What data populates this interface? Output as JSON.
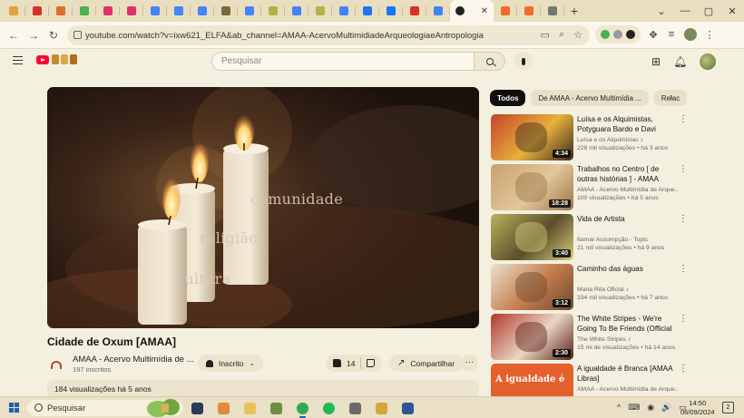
{
  "browser": {
    "tab_favicon_colors": [
      "#e0a33a",
      "#d93025",
      "#e06c2c",
      "#4caf50",
      "#e1306c",
      "#e1306c",
      "#4285f4",
      "#4285f4",
      "#4285f4",
      "#7a6a3a",
      "#4285f4",
      "#b7b04a",
      "#4285f4",
      "#b7b04a",
      "#4285f4",
      "#1877f2",
      "#1877f2",
      "#d93025",
      "#4285f4"
    ],
    "active_tab_icon": "youtube-music-icon",
    "after_tabs": [
      "#f36a2a",
      "#f36a2a",
      "#777777"
    ],
    "new_tab": "+",
    "url": "youtube.com/watch?v=ixw621_ELFA&ab_channel=AMAA-AcervoMultimidiadeArqueologiaeAntropologia",
    "window_controls": [
      "⌄",
      "—",
      "▢",
      "✕"
    ]
  },
  "masthead": {
    "search_placeholder": "Pesquisar"
  },
  "player": {
    "overlay_words": [
      "comunidade",
      "religião",
      "cultura"
    ]
  },
  "video": {
    "title": "Cidade de Oxum [AMAA]",
    "channel_name": "AMAA - Acervo Multimídia de ...",
    "subscribers": "197 inscritos",
    "subscribe_label": "Inscrito",
    "likes": "14",
    "share_label": "Compartilhar",
    "more_label": "···",
    "stats": "184 visualizações  há 5 anos"
  },
  "chips": [
    "Todos",
    "De AMAA - Acervo Multimídia ...",
    "Relac"
  ],
  "related": [
    {
      "title": "Luísa e os Alquimistas, Potyguara Bardo e Davi Sabbag...",
      "channel": "Luísa e os Alquimistas ♪",
      "meta": "228 mil visualizações • há 3 anos",
      "duration": "4:34",
      "thumb_colors": [
        "#c4432a",
        "#e7b13c",
        "#3c2a1e"
      ]
    },
    {
      "title": "Trabalhos no Centro [ de outras histórias ] - AMAA",
      "channel": "AMAA - Acervo Multimídia de Arque...",
      "meta": "100 visualizações • há 5 anos",
      "duration": "18:28",
      "thumb_colors": [
        "#c8a070",
        "#e2c89a",
        "#9c7446"
      ]
    },
    {
      "title": "Vida de Artista",
      "channel": "Itamar Assumpção - Topic",
      "meta": "21 mil visualizações • há 9 anos",
      "duration": "3:40",
      "thumb_colors": [
        "#b9b25a",
        "#5b4e2c",
        "#d9cf7c"
      ]
    },
    {
      "title": "Caminho das águas",
      "channel": "Maria Rita Oficial ♪",
      "meta": "334 mil visualizações • há 7 anos",
      "duration": "3:12",
      "thumb_colors": [
        "#e9e1cf",
        "#c47a4a",
        "#6b4a30"
      ]
    },
    {
      "title": "The White Stripes - We're Going To Be Friends (Official Music...",
      "channel": "The White Stripes ♪",
      "meta": "15 mi de visualizações • há 14 anos",
      "duration": "2:30",
      "thumb_colors": [
        "#b4372c",
        "#e8d6c2",
        "#5a1c16"
      ]
    },
    {
      "title": "A igualdade é Branca [AMAA Libras]",
      "channel": "AMAA - Acervo Multimídia de Arque...",
      "meta": "",
      "duration": "",
      "thumb_text": "A igualdade é",
      "thumb_colors": [
        "#e5602c",
        "#ffffff",
        "#7a2a14"
      ]
    }
  ],
  "taskbar": {
    "search_label": "Pesquisar",
    "app_colors": [
      "#2b3b5c",
      "#e08a3a",
      "#e6c35a",
      "#6d8f3f",
      "#34a853",
      "#1db954",
      "#6a6a6a",
      "#d4a63a",
      "#2b5797"
    ],
    "tray_icons": [
      "^",
      "⌨",
      "◉",
      "🔊",
      "▭"
    ],
    "time": "14:50",
    "date": "06/09/2024",
    "notifications": "2"
  }
}
